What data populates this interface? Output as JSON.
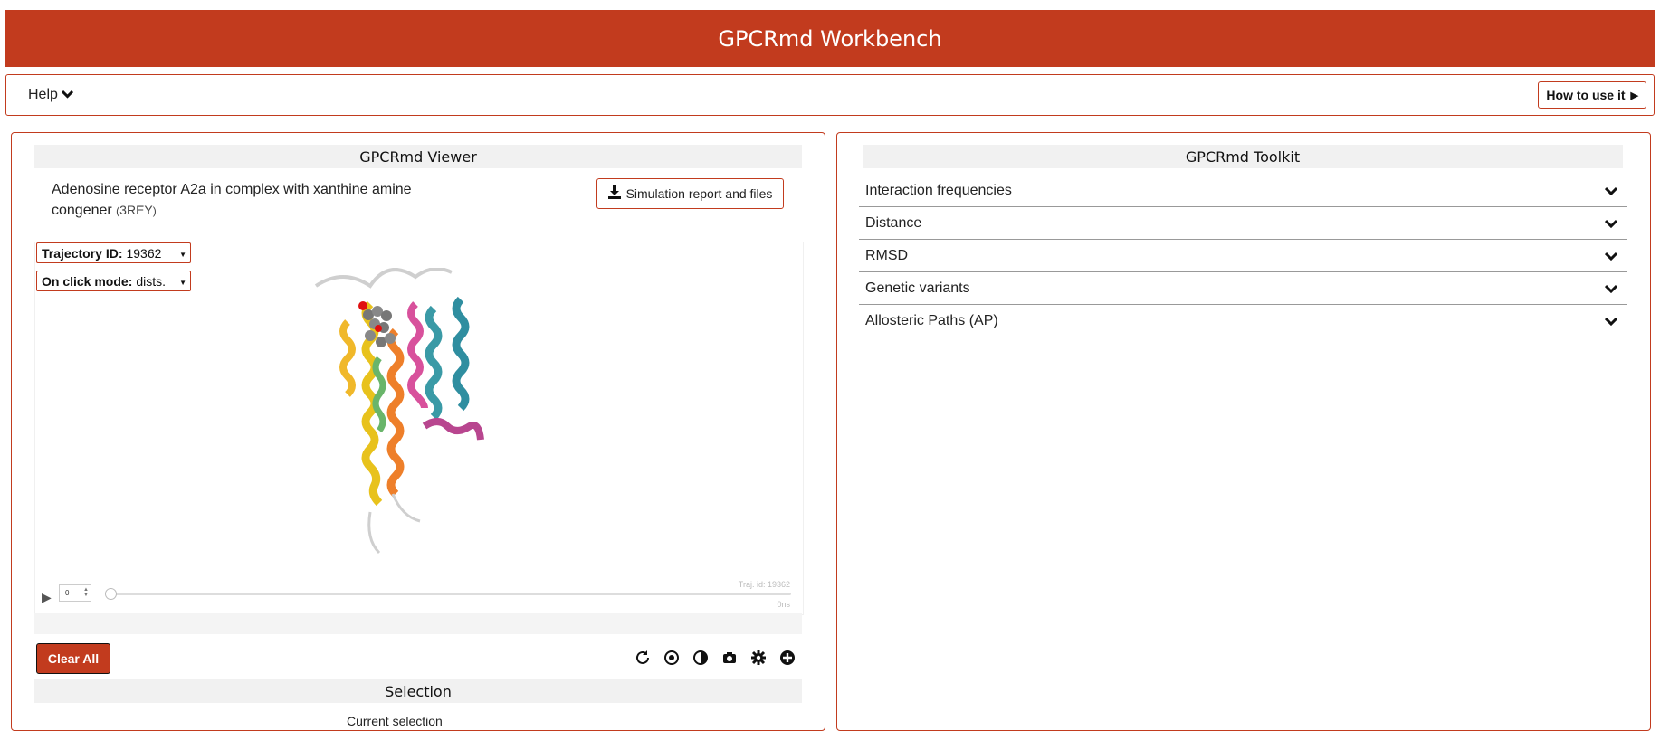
{
  "header": {
    "title": "GPCRmd Workbench"
  },
  "helpbar": {
    "help_label": "Help",
    "help_icon": "chevron-down-icon",
    "howto_label": "How to use it",
    "howto_icon": "triangle-right-icon"
  },
  "viewer_panel": {
    "title": "GPCRmd Viewer",
    "simulation_title": "Adenosine receptor A2a in complex with xanthine amine congener",
    "pdb_open": "(",
    "pdb_id": "3REY",
    "pdb_close": ")",
    "report_button_label": "Simulation report and files",
    "report_button_icon": "download-icon",
    "trajectory_select": {
      "label": "Trajectory ID:",
      "value": "19362"
    },
    "click_mode_select": {
      "label": "On click mode:",
      "value": "dists."
    },
    "overlay_traj_id": "Traj. id: 19362",
    "overlay_time": "0ns",
    "frame_value": "0",
    "clear_button_label": "Clear All",
    "toolbar_icons": [
      "refresh-icon",
      "center-icon",
      "contrast-icon",
      "camera-icon",
      "gear-icon",
      "plus-circle-icon"
    ],
    "selection_title": "Selection",
    "selection_subtext": "Current selection"
  },
  "toolkit_panel": {
    "title": "GPCRmd Toolkit",
    "items": [
      {
        "label": "Interaction frequencies"
      },
      {
        "label": "Distance"
      },
      {
        "label": "RMSD"
      },
      {
        "label": "Genetic variants"
      },
      {
        "label": "Allosteric Paths (AP)"
      }
    ]
  },
  "colors": {
    "brand": "#c23b1e",
    "header_bg": "#f1f1f1"
  }
}
